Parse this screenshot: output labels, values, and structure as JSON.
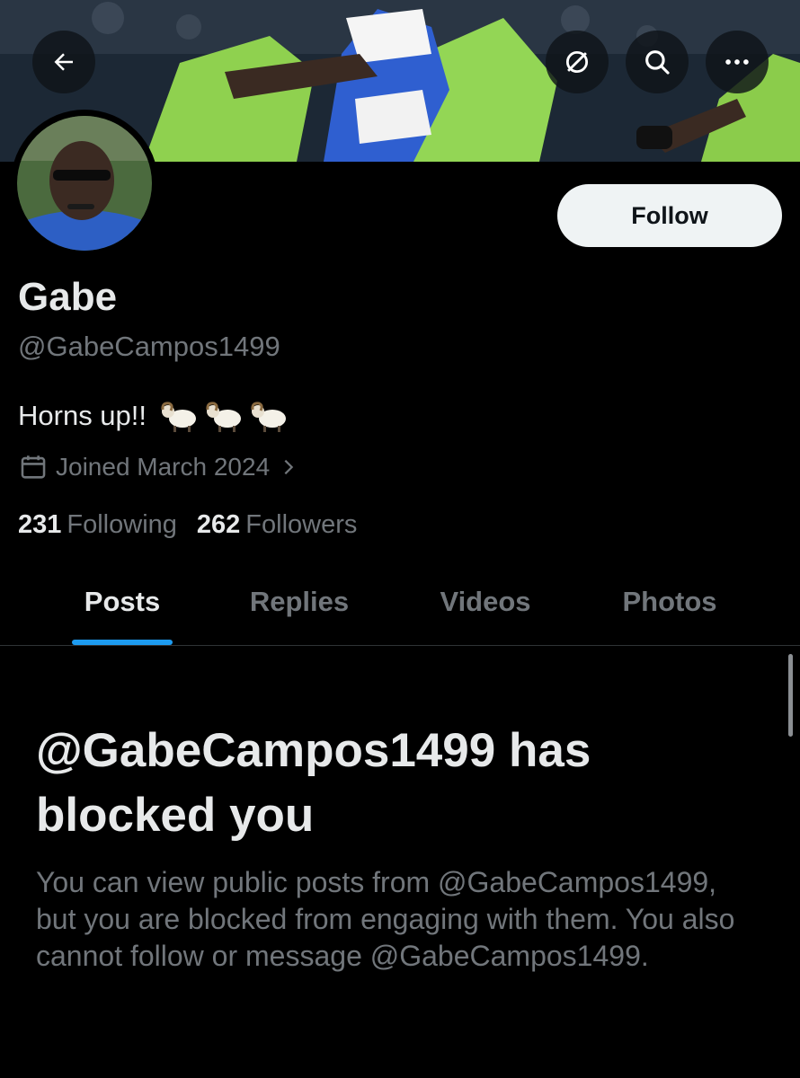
{
  "header": {
    "back_icon": "arrow-left-icon",
    "grok_icon": "grok-icon",
    "search_icon": "search-icon",
    "more_icon": "more-horizontal-icon"
  },
  "profile": {
    "display_name": "Gabe",
    "handle": "@GabeCampos1499",
    "bio_text": "Horns up!!",
    "bio_emoji": [
      "🐏",
      "🐏",
      "🐏"
    ],
    "joined": "Joined March 2024",
    "following_count": "231",
    "following_label": "Following",
    "followers_count": "262",
    "followers_label": "Followers",
    "follow_button": "Follow"
  },
  "tabs": [
    {
      "label": "Posts",
      "active": true
    },
    {
      "label": "Replies",
      "active": false
    },
    {
      "label": "Videos",
      "active": false
    },
    {
      "label": "Photos",
      "active": false
    }
  ],
  "blocked": {
    "title": "@GabeCampos1499 has blocked you",
    "description": "You can view public posts from @GabeCampos1499, but you are blocked from engaging with them. You also cannot follow or message @GabeCampos1499."
  },
  "colors": {
    "background": "#000000",
    "text_primary": "#e7e9ea",
    "text_secondary": "#71767b",
    "accent": "#1d9bf0",
    "follow_button_bg": "#eff3f4",
    "divider": "#2f3336"
  }
}
